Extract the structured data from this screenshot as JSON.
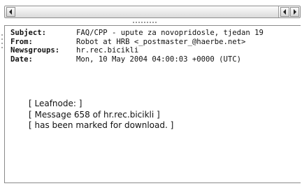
{
  "scrollbar": {
    "left_arrow_icon": "triangle-left-icon",
    "right_arrow_icon": "triangle-right-icon"
  },
  "message": {
    "headers": [
      {
        "key": "Subject:",
        "value": "FAQ/CPP - upute za novopridosle, tjedan 19"
      },
      {
        "key": "From:",
        "value": "Robot at HRB <_postmaster_@haerbe.net>"
      },
      {
        "key": "Newsgroups:",
        "value": "hr.rec.bicikli"
      },
      {
        "key": "Date:",
        "value": "Mon, 10 May 2004 04:00:03 +0000 (UTC)"
      }
    ],
    "body_lines": [
      "[ Leafnode: ]",
      "[ Message 658 of hr.rec.bicikli ]",
      "[ has been marked for download. ]"
    ]
  }
}
